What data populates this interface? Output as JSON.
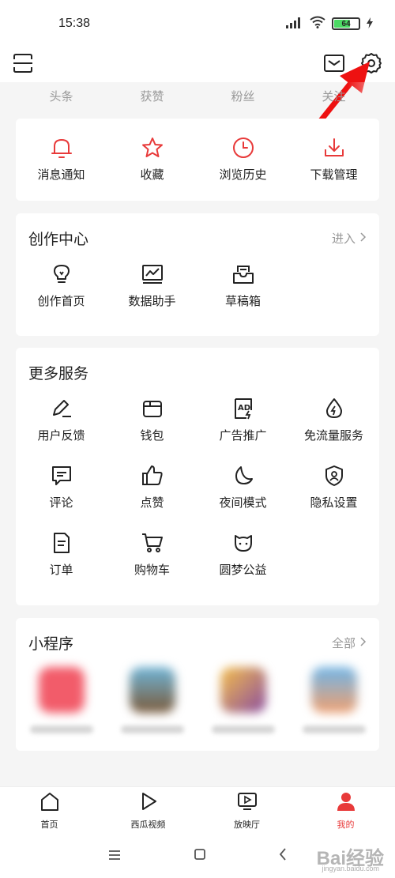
{
  "status_bar": {
    "time": "15:38",
    "battery": "64"
  },
  "stats": [
    "头条",
    "获赞",
    "粉丝",
    "关注"
  ],
  "quick_actions": [
    {
      "label": "消息通知",
      "icon": "bell-icon"
    },
    {
      "label": "收藏",
      "icon": "star-icon"
    },
    {
      "label": "浏览历史",
      "icon": "clock-icon"
    },
    {
      "label": "下载管理",
      "icon": "download-icon"
    }
  ],
  "creator_center": {
    "title": "创作中心",
    "link": "进入",
    "items": [
      {
        "label": "创作首页",
        "icon": "lightbulb-icon"
      },
      {
        "label": "数据助手",
        "icon": "chart-icon"
      },
      {
        "label": "草稿箱",
        "icon": "draft-box-icon"
      }
    ]
  },
  "more_services": {
    "title": "更多服务",
    "items": [
      {
        "label": "用户反馈",
        "icon": "pen-icon"
      },
      {
        "label": "钱包",
        "icon": "wallet-icon"
      },
      {
        "label": "广告推广",
        "icon": "ad-icon"
      },
      {
        "label": "免流量服务",
        "icon": "water-drop-icon"
      },
      {
        "label": "评论",
        "icon": "comment-icon"
      },
      {
        "label": "点赞",
        "icon": "thumbs-up-icon"
      },
      {
        "label": "夜间模式",
        "icon": "moon-icon"
      },
      {
        "label": "隐私设置",
        "icon": "shield-user-icon"
      },
      {
        "label": "订单",
        "icon": "document-icon"
      },
      {
        "label": "购物车",
        "icon": "cart-icon"
      },
      {
        "label": "圆梦公益",
        "icon": "cat-face-icon"
      }
    ]
  },
  "mini_programs": {
    "title": "小程序",
    "link": "全部",
    "colors": [
      "#f25c6a",
      "#7aa06a",
      "#e8a85a",
      "#f0a070"
    ]
  },
  "bottom_nav": [
    {
      "label": "首页",
      "icon": "home-icon"
    },
    {
      "label": "西瓜视频",
      "icon": "play-icon"
    },
    {
      "label": "放映厅",
      "icon": "tv-icon"
    },
    {
      "label": "我的",
      "icon": "person-icon",
      "active": true
    }
  ],
  "watermark": "Bai经验",
  "watermark_sub": "jingyan.baidu.com",
  "colors": {
    "accent": "#e83a3a",
    "text": "#222222",
    "muted": "#999999",
    "bg": "#f5f5f5"
  }
}
